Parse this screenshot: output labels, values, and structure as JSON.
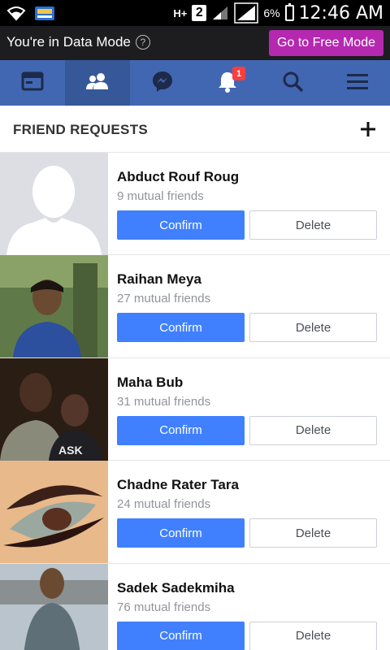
{
  "status_bar": {
    "battery": "6%",
    "time": "12:46 AM",
    "sim": "2",
    "network": "H+"
  },
  "data_mode": {
    "message": "You're in Data Mode",
    "button": "Go to Free Mode",
    "button_color": "#b528b0"
  },
  "nav": {
    "items": [
      {
        "icon": "news-feed-icon"
      },
      {
        "icon": "friends-icon"
      },
      {
        "icon": "messenger-icon"
      },
      {
        "icon": "notifications-icon",
        "badge": "1"
      },
      {
        "icon": "search-icon"
      },
      {
        "icon": "menu-icon"
      }
    ],
    "color": "#4267b2"
  },
  "section": {
    "title": "FRIEND REQUESTS"
  },
  "requests": [
    {
      "name": "Abduct Rouf Roug",
      "mutual": "9 mutual friends",
      "confirm": "Confirm",
      "delete": "Delete"
    },
    {
      "name": "Raihan Meya",
      "mutual": "27 mutual friends",
      "confirm": "Confirm",
      "delete": "Delete"
    },
    {
      "name": "Maha Bub",
      "mutual": "31 mutual friends",
      "confirm": "Confirm",
      "delete": "Delete"
    },
    {
      "name": "Chadne Rater Tara",
      "mutual": "24 mutual friends",
      "confirm": "Confirm",
      "delete": "Delete"
    },
    {
      "name": "Sadek Sadekmiha",
      "mutual": "76 mutual friends",
      "confirm": "Confirm",
      "delete": "Delete"
    }
  ]
}
